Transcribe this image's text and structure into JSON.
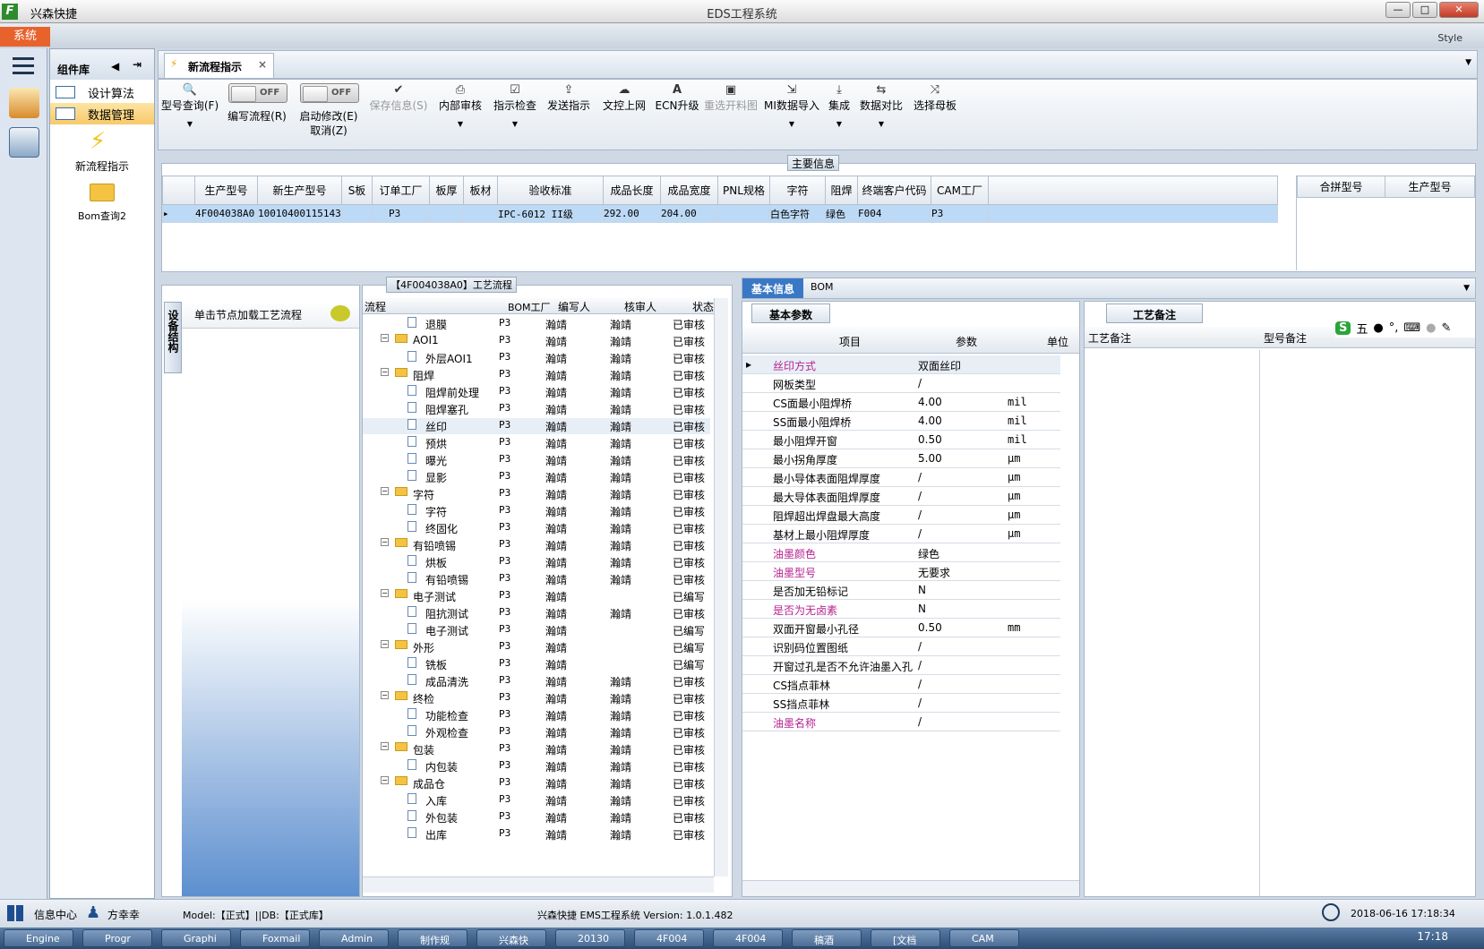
{
  "app": {
    "logo": "F",
    "name": "兴森快捷",
    "title": "EDS工程系统",
    "system_btn": "系统",
    "style_label": "Style"
  },
  "window_controls": [
    "—",
    "□",
    "✕"
  ],
  "nav": {
    "header": "组件库",
    "items": [
      "设计算法",
      "数据管理"
    ],
    "tools": [
      "新流程指示",
      "Bom查询2"
    ]
  },
  "tab": {
    "label": "新流程指示",
    "close": "×"
  },
  "toolbar": {
    "type_query": "型号查询(F)",
    "write_flow": "编写流程(R)",
    "write_flow_state": "OFF",
    "start_modify": "启动修改(E)",
    "start_modify_state": "OFF",
    "cancel": "取消(Z)",
    "buttons": [
      {
        "label": "保存信息(S)",
        "icon": "check-icon",
        "disabled": true
      },
      {
        "label": "内部审核",
        "icon": "print-icon",
        "disabled": false
      },
      {
        "label": "指示检查",
        "icon": "checkbox-icon",
        "disabled": false
      },
      {
        "label": "发送指示",
        "icon": "upload-icon",
        "disabled": false
      },
      {
        "label": "文控上网",
        "icon": "cloud-upload-icon",
        "disabled": false
      },
      {
        "label": "ECN升级",
        "icon": "font-icon",
        "disabled": false
      },
      {
        "label": "重选开料图",
        "icon": "image-icon",
        "disabled": true
      },
      {
        "label": "MI数据导入",
        "icon": "import-icon",
        "disabled": false
      },
      {
        "label": "集成",
        "icon": "download-icon",
        "disabled": false
      },
      {
        "label": "数据对比",
        "icon": "compare-icon",
        "disabled": false
      },
      {
        "label": "选择母板",
        "icon": "shuffle-icon",
        "disabled": false
      }
    ]
  },
  "main_info": {
    "title": "主要信息",
    "columns": [
      "生产型号",
      "新生产型号",
      "S板",
      "订单工厂",
      "板厚",
      "板材",
      "验收标准",
      "成品长度",
      "成品宽度",
      "PNL规格",
      "字符",
      "阻焊",
      "终端客户代码",
      "CAM工厂"
    ],
    "row": [
      "4F004038A0",
      "10010400115143",
      "",
      "P3",
      "",
      "",
      "IPC-6012 II级",
      "292.00",
      "204.00",
      "",
      "白色字符",
      "绿色",
      "F004",
      "P3"
    ],
    "side_columns": [
      "合拼型号",
      "生产型号"
    ]
  },
  "flow": {
    "vertical_tab": "设备结构",
    "hint": "单击节点加载工艺流程",
    "title": "【4F004038A0】工艺流程",
    "columns": [
      "流程",
      "BOM工厂",
      "编写人",
      "核审人",
      "状态"
    ],
    "rows": [
      {
        "name": "退膜",
        "level": 2,
        "factory": "P3",
        "writer": "瀚靖",
        "reviewer": "瀚靖",
        "status": "已审核"
      },
      {
        "name": "AOI1",
        "level": 1,
        "factory": "P3",
        "writer": "瀚靖",
        "reviewer": "瀚靖",
        "status": "已审核"
      },
      {
        "name": "外层AOI1",
        "level": 2,
        "factory": "P3",
        "writer": "瀚靖",
        "reviewer": "瀚靖",
        "status": "已审核"
      },
      {
        "name": "阻焊",
        "level": 1,
        "factory": "P3",
        "writer": "瀚靖",
        "reviewer": "瀚靖",
        "status": "已审核"
      },
      {
        "name": "阻焊前处理",
        "level": 2,
        "factory": "P3",
        "writer": "瀚靖",
        "reviewer": "瀚靖",
        "status": "已审核"
      },
      {
        "name": "阻焊塞孔",
        "level": 2,
        "factory": "P3",
        "writer": "瀚靖",
        "reviewer": "瀚靖",
        "status": "已审核"
      },
      {
        "name": "丝印",
        "level": 2,
        "factory": "P3",
        "writer": "瀚靖",
        "reviewer": "瀚靖",
        "status": "已审核"
      },
      {
        "name": "预烘",
        "level": 2,
        "factory": "P3",
        "writer": "瀚靖",
        "reviewer": "瀚靖",
        "status": "已审核"
      },
      {
        "name": "曝光",
        "level": 2,
        "factory": "P3",
        "writer": "瀚靖",
        "reviewer": "瀚靖",
        "status": "已审核"
      },
      {
        "name": "显影",
        "level": 2,
        "factory": "P3",
        "writer": "瀚靖",
        "reviewer": "瀚靖",
        "status": "已审核"
      },
      {
        "name": "字符",
        "level": 1,
        "factory": "P3",
        "writer": "瀚靖",
        "reviewer": "瀚靖",
        "status": "已审核"
      },
      {
        "name": "字符",
        "level": 2,
        "factory": "P3",
        "writer": "瀚靖",
        "reviewer": "瀚靖",
        "status": "已审核"
      },
      {
        "name": "终固化",
        "level": 2,
        "factory": "P3",
        "writer": "瀚靖",
        "reviewer": "瀚靖",
        "status": "已审核"
      },
      {
        "name": "有铅喷锡",
        "level": 1,
        "factory": "P3",
        "writer": "瀚靖",
        "reviewer": "瀚靖",
        "status": "已审核"
      },
      {
        "name": "烘板",
        "level": 2,
        "factory": "P3",
        "writer": "瀚靖",
        "reviewer": "瀚靖",
        "status": "已审核"
      },
      {
        "name": "有铅喷锡",
        "level": 2,
        "factory": "P3",
        "writer": "瀚靖",
        "reviewer": "瀚靖",
        "status": "已审核"
      },
      {
        "name": "电子测试",
        "level": 1,
        "factory": "P3",
        "writer": "瀚靖",
        "reviewer": "",
        "status": "已编写"
      },
      {
        "name": "阻抗测试",
        "level": 2,
        "factory": "P3",
        "writer": "瀚靖",
        "reviewer": "瀚靖",
        "status": "已审核"
      },
      {
        "name": "电子测试",
        "level": 2,
        "factory": "P3",
        "writer": "瀚靖",
        "reviewer": "",
        "status": "已编写"
      },
      {
        "name": "外形",
        "level": 1,
        "factory": "P3",
        "writer": "瀚靖",
        "reviewer": "",
        "status": "已编写"
      },
      {
        "name": "铣板",
        "level": 2,
        "factory": "P3",
        "writer": "瀚靖",
        "reviewer": "",
        "status": "已编写"
      },
      {
        "name": "成品清洗",
        "level": 2,
        "factory": "P3",
        "writer": "瀚靖",
        "reviewer": "瀚靖",
        "status": "已审核"
      },
      {
        "name": "终检",
        "level": 1,
        "factory": "P3",
        "writer": "瀚靖",
        "reviewer": "瀚靖",
        "status": "已审核"
      },
      {
        "name": "功能检查",
        "level": 2,
        "factory": "P3",
        "writer": "瀚靖",
        "reviewer": "瀚靖",
        "status": "已审核"
      },
      {
        "name": "外观检查",
        "level": 2,
        "factory": "P3",
        "writer": "瀚靖",
        "reviewer": "瀚靖",
        "status": "已审核"
      },
      {
        "name": "包装",
        "level": 1,
        "factory": "P3",
        "writer": "瀚靖",
        "reviewer": "瀚靖",
        "status": "已审核"
      },
      {
        "name": "内包装",
        "level": 2,
        "factory": "P3",
        "writer": "瀚靖",
        "reviewer": "瀚靖",
        "status": "已审核"
      },
      {
        "name": "成品仓",
        "level": 1,
        "factory": "P3",
        "writer": "瀚靖",
        "reviewer": "瀚靖",
        "status": "已审核"
      },
      {
        "name": "入库",
        "level": 2,
        "factory": "P3",
        "writer": "瀚靖",
        "reviewer": "瀚靖",
        "status": "已审核"
      },
      {
        "name": "外包装",
        "level": 2,
        "factory": "P3",
        "writer": "瀚靖",
        "reviewer": "瀚靖",
        "status": "已审核"
      },
      {
        "name": "出库",
        "level": 2,
        "factory": "P3",
        "writer": "瀚靖",
        "reviewer": "瀚靖",
        "status": "已审核"
      }
    ]
  },
  "right_tabs": [
    "基本信息",
    "BOM"
  ],
  "params": {
    "title": "基本参数",
    "columns": [
      "项目",
      "参数",
      "单位"
    ],
    "rows": [
      {
        "item": "丝印方式",
        "value": "双面丝印",
        "unit": "",
        "pink": true
      },
      {
        "item": "网板类型",
        "value": "/",
        "unit": "",
        "pink": false
      },
      {
        "item": "CS面最小阻焊桥",
        "value": "4.00",
        "unit": "mil",
        "pink": false
      },
      {
        "item": "SS面最小阻焊桥",
        "value": "4.00",
        "unit": "mil",
        "pink": false
      },
      {
        "item": "最小阻焊开窗",
        "value": "0.50",
        "unit": "mil",
        "pink": false
      },
      {
        "item": "最小拐角厚度",
        "value": "5.00",
        "unit": "μm",
        "pink": false
      },
      {
        "item": "最小导体表面阻焊厚度",
        "value": "/",
        "unit": "μm",
        "pink": false
      },
      {
        "item": "最大导体表面阻焊厚度",
        "value": "/",
        "unit": "μm",
        "pink": false
      },
      {
        "item": "阻焊超出焊盘最大高度",
        "value": "/",
        "unit": "μm",
        "pink": false
      },
      {
        "item": "基材上最小阻焊厚度",
        "value": "/",
        "unit": "μm",
        "pink": false
      },
      {
        "item": "油墨颜色",
        "value": "绿色",
        "unit": "",
        "pink": true
      },
      {
        "item": "油墨型号",
        "value": "无要求",
        "unit": "",
        "pink": true
      },
      {
        "item": "是否加无铅标记",
        "value": "N",
        "unit": "",
        "pink": false
      },
      {
        "item": "是否为无卤素",
        "value": "N",
        "unit": "",
        "pink": true
      },
      {
        "item": "双面开窗最小孔径",
        "value": "0.50",
        "unit": "mm",
        "pink": false
      },
      {
        "item": "识别码位置图纸",
        "value": "/",
        "unit": "",
        "pink": false
      },
      {
        "item": "开窗过孔是否不允许油墨入孔",
        "value": "/",
        "unit": "",
        "pink": false
      },
      {
        "item": "CS挡点菲林",
        "value": "/",
        "unit": "",
        "pink": false
      },
      {
        "item": "SS挡点菲林",
        "value": "/",
        "unit": "",
        "pink": false
      },
      {
        "item": "油墨名称",
        "value": "/",
        "unit": "",
        "pink": true
      }
    ]
  },
  "notes": {
    "title": "工艺备注",
    "columns": [
      "工艺备注",
      "型号备注"
    ]
  },
  "ime": {
    "mode": "五"
  },
  "status": {
    "info_center": "信息中心",
    "user": "方幸幸",
    "model": "Model:【正式】||DB:【正式库】",
    "version": "兴森快捷 EMS工程系统 Version: 1.0.1.482",
    "datetime": "2018-06-16 17:18:34"
  },
  "taskbar": {
    "items": [
      "Engine",
      "Progr",
      "Graphi",
      "Foxmail",
      "Admin",
      "制作规",
      "兴森快",
      "20130",
      "4F004",
      "4F004",
      "稿酒",
      "[文档",
      "CAM"
    ],
    "clock": "17:18"
  }
}
